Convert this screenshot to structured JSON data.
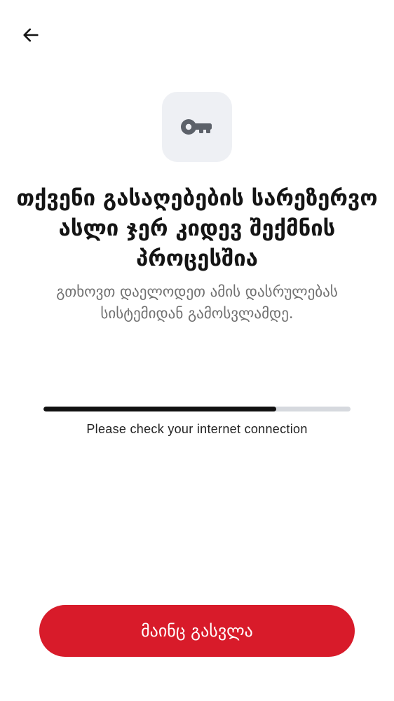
{
  "header": {
    "back_icon": "arrow-left-icon"
  },
  "hero": {
    "icon": "key-icon",
    "title": "თქვენი გასაღებების სარეზერვო ასლი ჯერ კიდევ შექმნის პროცესშია",
    "subtitle": "გთხოვთ დაელოდეთ ამის დასრულებას სისტემიდან გამოსვლამდე."
  },
  "progress": {
    "fraction": 0.758,
    "status_text": "Please check your internet connection"
  },
  "footer": {
    "button_label": "მაინც გასვლა"
  },
  "colors": {
    "accent": "#d81b2a",
    "progress_fill": "#111111",
    "progress_track": "#d6d9de",
    "icon_tile": "#eef0f4",
    "icon": "#5c6169"
  }
}
